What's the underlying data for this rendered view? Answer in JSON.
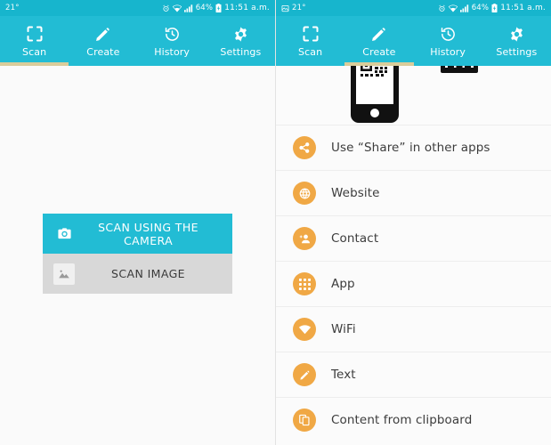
{
  "status_bar": {
    "temperature": "21°",
    "battery_percent": "64%",
    "time": "11:51 a.m.",
    "icons_left_screen": [
      "alarm-icon",
      "wifi-icon",
      "signal-icon",
      "battery-charging-icon"
    ],
    "icons_right_screen": [
      "screenshot-icon",
      "alarm-icon",
      "wifi-icon",
      "signal-icon",
      "battery-charging-icon"
    ]
  },
  "colors": {
    "brand_cyan": "#22bcd4",
    "status_bar_cyan": "#17b5cd",
    "tab_indicator": "#d9cc9a",
    "accent_orange": "#f0a845",
    "button_gray": "#d8d8d8",
    "page_background": "#fbfbfb"
  },
  "tabs": [
    {
      "label": "Scan",
      "icon": "scan-frame-icon"
    },
    {
      "label": "Create",
      "icon": "pencil-icon"
    },
    {
      "label": "History",
      "icon": "history-clock-icon"
    },
    {
      "label": "Settings",
      "icon": "gear-icon"
    }
  ],
  "left_screen": {
    "active_tab_index": 0,
    "buttons": [
      {
        "label": "SCAN USING THE CAMERA",
        "icon": "camera-icon",
        "style": "primary"
      },
      {
        "label": "SCAN IMAGE",
        "icon": "image-icon",
        "style": "secondary"
      }
    ]
  },
  "right_screen": {
    "active_tab_index": 1,
    "hero": {
      "items": [
        "phone-with-qr-code-art",
        "card-scanner-art"
      ]
    },
    "create_options": [
      {
        "label": "Use “Share” in other apps",
        "icon": "share-icon"
      },
      {
        "label": "Website",
        "icon": "globe-icon"
      },
      {
        "label": "Contact",
        "icon": "contact-add-icon"
      },
      {
        "label": "App",
        "icon": "apps-grid-icon"
      },
      {
        "label": "WiFi",
        "icon": "wifi-signal-icon"
      },
      {
        "label": "Text",
        "icon": "pencil-icon"
      },
      {
        "label": "Content from clipboard",
        "icon": "clipboard-copy-icon"
      }
    ]
  }
}
